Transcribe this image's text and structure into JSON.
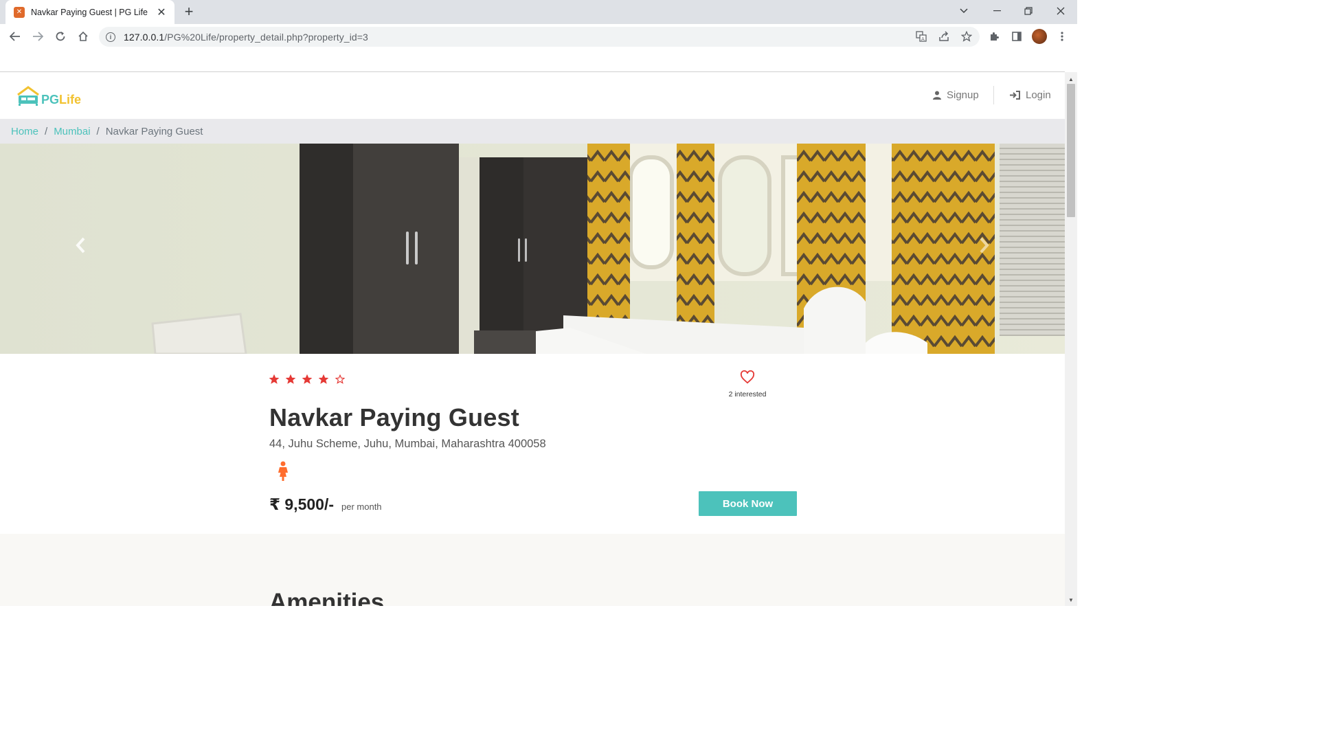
{
  "browser": {
    "tab_title": "Navkar Paying Guest | PG Life",
    "url_host": "127.0.0.1",
    "url_path": "/PG%20Life/property_detail.php?property_id=3"
  },
  "navbar": {
    "logo_pg": "PG",
    "logo_life": "Life",
    "signup_label": "Signup",
    "login_label": "Login"
  },
  "breadcrumb": {
    "items": [
      "Home",
      "Mumbai"
    ],
    "current": "Navkar Paying Guest"
  },
  "property": {
    "name": "Navkar Paying Guest",
    "address": "44, Juhu Scheme, Juhu, Mumbai, Maharashtra 400058",
    "rating": 4,
    "rating_max": 5,
    "interested_text": "2 interested",
    "gender_icon": "female-icon",
    "rent": "₹ 9,500/-",
    "rent_unit": "per month",
    "book_label": "Book Now"
  },
  "amenities": {
    "title": "Amenities"
  },
  "colors": {
    "brand_teal": "#4cc2bb",
    "brand_yellow": "#f2c230",
    "star_red": "#e53935",
    "gender_orange": "#ff6d2e"
  }
}
